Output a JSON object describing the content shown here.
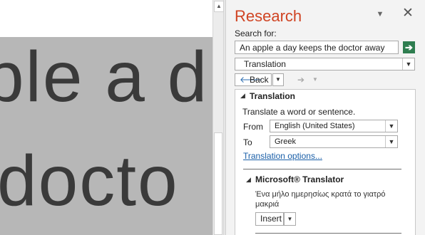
{
  "document": {
    "line1": "ple a d",
    "line2": "docto"
  },
  "scrollbar": {
    "up_arrow": "▲"
  },
  "pane": {
    "title": "Research",
    "menu_icon": "▼",
    "close_icon": "✕",
    "search_label": "Search for:",
    "search_value": "An apple a day keeps the doctor away",
    "go_icon": "➔",
    "service_value": "Translation",
    "dropdown_icon": "▼",
    "back_icon": "🡐",
    "back_label": "Back",
    "forward_icon": "➔",
    "results": {
      "section_toggle": "◢",
      "section_title": "Translation",
      "description": "Translate a word or sentence.",
      "from_label": "From",
      "from_value": "English (United States)",
      "to_label": "To",
      "to_value": "Greek",
      "options_link": "Translation options...",
      "provider_toggle": "◢",
      "provider_title": "Microsoft® Translator",
      "translated_text": "Ένα μήλο ημερησίως κρατά το γιατρό μακριά",
      "insert_label": "Insert"
    }
  }
}
